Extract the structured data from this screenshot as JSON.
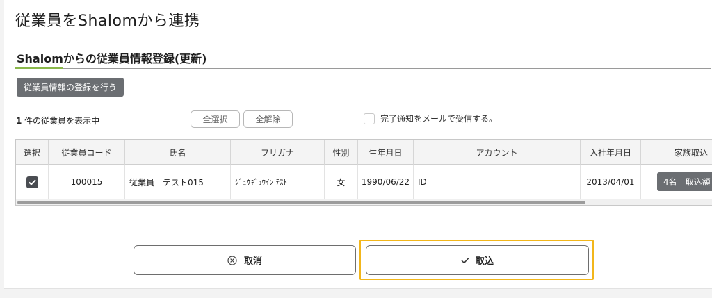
{
  "page": {
    "title": "従業員をShalomから連携"
  },
  "section": {
    "title": "Shalomからの従業員情報登録(更新)"
  },
  "toolbar": {
    "register_label": "従業員情報の登録を行う",
    "count_number": "1",
    "count_suffix": " 件の従業員を表示中",
    "select_all_label": "全選択",
    "deselect_all_label": "全解除",
    "notify_label": "完了通知をメールで受信する。"
  },
  "table": {
    "headers": {
      "select": "選択",
      "code": "従業員コード",
      "name": "氏名",
      "furigana": "フリガナ",
      "gender": "性別",
      "birth": "生年月日",
      "account": "アカウント",
      "joined": "入社年月日",
      "family": "家族取込"
    },
    "rows": [
      {
        "checked": true,
        "code": "100015",
        "name": "従業員　テスト015",
        "furigana": "ｼﾞｭｳｷﾞｮｳｲﾝ ﾃｽﾄ",
        "gender": "女",
        "birth": "1990/06/22",
        "account": "ID",
        "joined": "2013/04/01",
        "family_badge": "4名　取込額"
      }
    ]
  },
  "actions": {
    "cancel_label": "取消",
    "import_label": "取込"
  },
  "colors": {
    "accent_green": "#8ab84a",
    "dark_button": "#6b6e72",
    "focus_ring": "#f2b61b"
  }
}
